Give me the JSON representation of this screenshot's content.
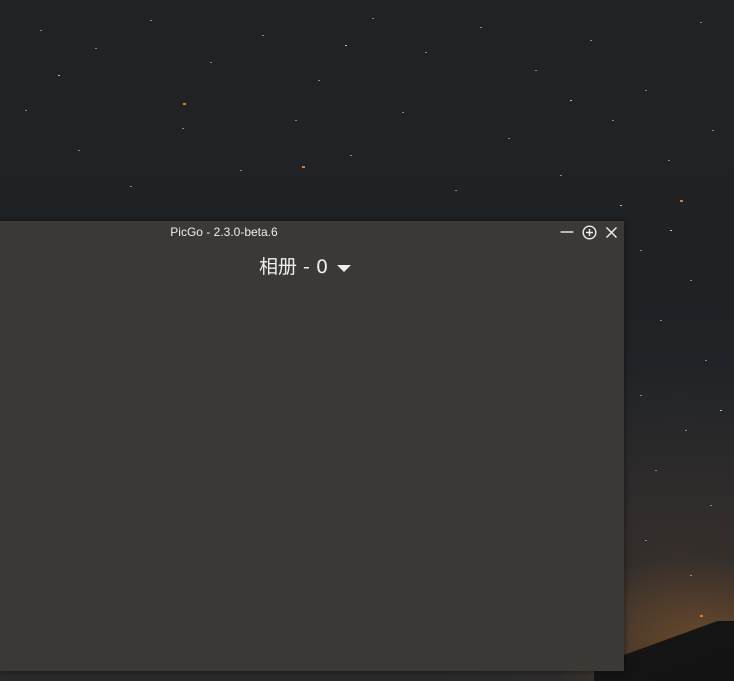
{
  "window": {
    "title": "PicGo - 2.3.0-beta.6",
    "controls": {
      "minimize_icon": "minimize-icon",
      "pin_icon": "pin-icon",
      "close_icon": "close-icon"
    }
  },
  "gallery": {
    "title": "相册",
    "separator": "-",
    "count": "0",
    "dropdown_icon": "caret-down-icon"
  },
  "colors": {
    "window_background": "#3b3935",
    "text": "#eeeeee",
    "desktop_background": "#202326"
  }
}
